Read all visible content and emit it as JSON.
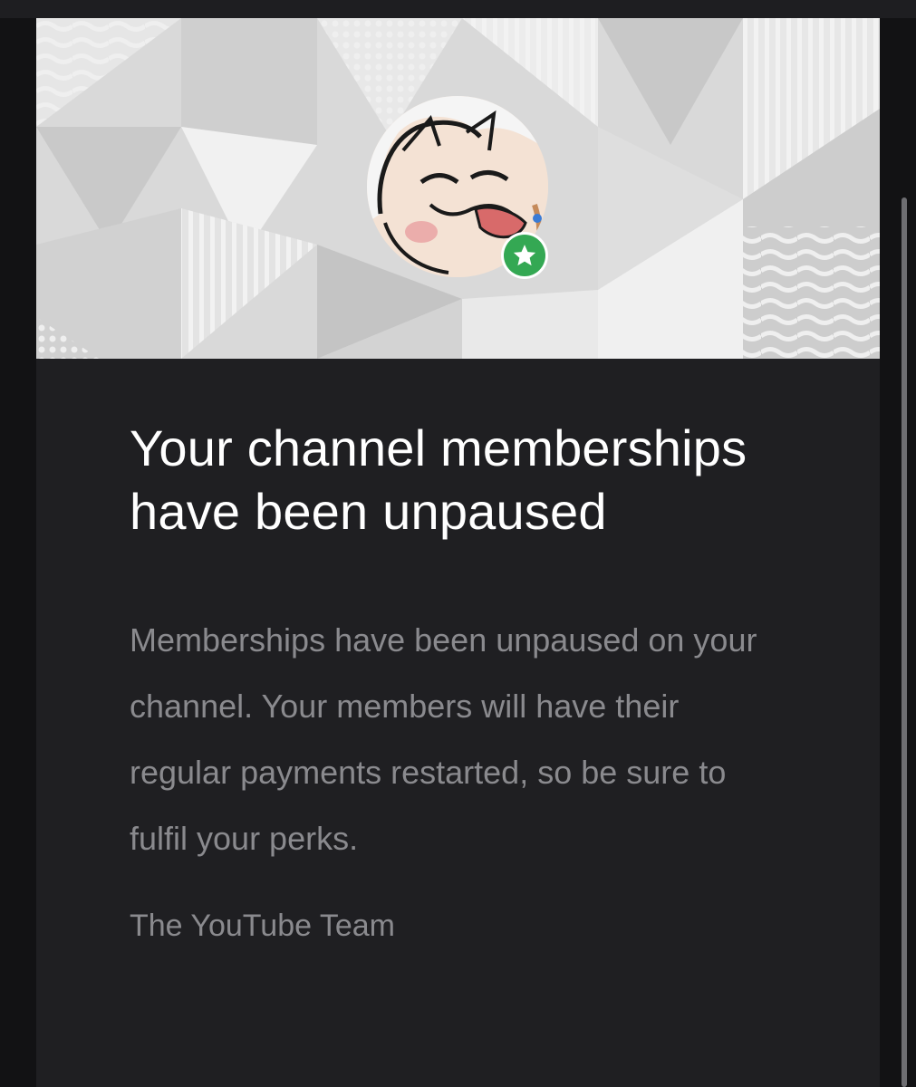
{
  "email": {
    "headline": "Your channel memberships have been unpaused",
    "body": "Memberships have been unpaused on your channel. Your members will have their regular payments restarted, so be sure to fulfil your perks.",
    "signoff": "The YouTube Team"
  },
  "banner": {
    "avatar_icon": "channel-avatar",
    "badge_icon": "star-icon",
    "badge_color": "#34a853"
  },
  "colors": {
    "background": "#1f1f22",
    "headline": "#ffffff",
    "body": "#8a8a8e"
  }
}
